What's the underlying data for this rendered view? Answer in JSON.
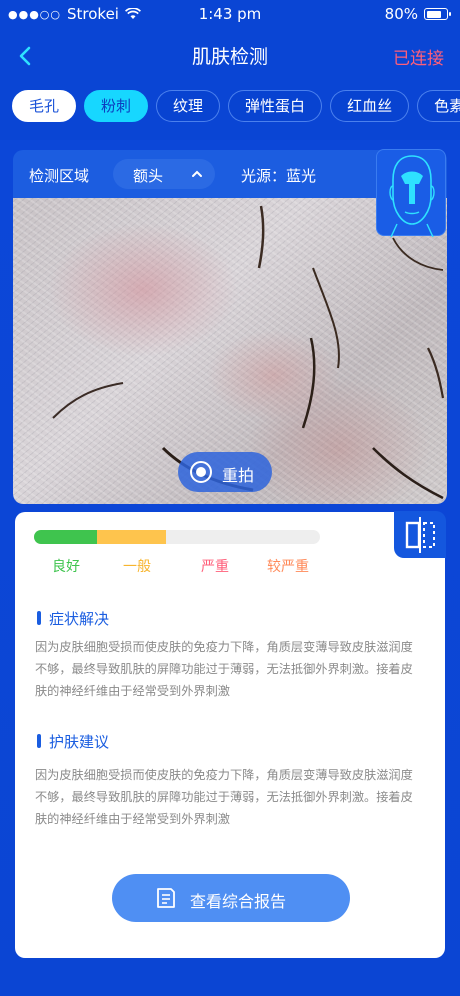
{
  "status_bar": {
    "carrier": "Strokei",
    "time": "1:43 pm",
    "battery_percent_text": "80%",
    "battery_level": 0.8
  },
  "nav": {
    "title": "肌肤检测",
    "connection_status": "已连接",
    "connection_color": "#ff5f7a"
  },
  "tabs": [
    {
      "label": "毛孔",
      "state": "white"
    },
    {
      "label": "粉刺",
      "state": "cyan"
    },
    {
      "label": "纹理",
      "state": "normal"
    },
    {
      "label": "弹性蛋白",
      "state": "normal"
    },
    {
      "label": "红血丝",
      "state": "normal"
    },
    {
      "label": "色素",
      "state": "normal"
    }
  ],
  "detection": {
    "region_label": "检测区域",
    "region_value": "额头",
    "light_source": "光源：蓝光",
    "retake_label": "重拍"
  },
  "severity": {
    "green_fraction": 0.22,
    "yellow_fraction": 0.24,
    "levels": [
      {
        "label": "良好",
        "color": "#3fc44e"
      },
      {
        "label": "一般",
        "color": "#f7b52e"
      },
      {
        "label": "严重",
        "color": "#ff5f7a"
      },
      {
        "label": "较严重",
        "color": "#ff8a5a"
      }
    ]
  },
  "symptom": {
    "title": "症状解决",
    "lines": [
      "因为皮肤细胞受损而使皮肤的免疫力下降，角质层变薄导致皮肤滋润度",
      "不够，最终导致肌肤的屏障功能过于薄弱，无法抵御外界刺激。接着皮",
      "肤的神经纤维由于经常受到外界刺激"
    ]
  },
  "advice": {
    "title": "护肤建议",
    "lines": [
      "因为皮肤细胞受损而使皮肤的免疫力下降，角质层变薄导致皮肤滋润度",
      "不够，最终导致肌肤的屏障功能过于薄弱，无法抵御外界刺激。接着皮",
      "肤的神经纤维由于经常受到外界刺激"
    ]
  },
  "report_button": "查看综合报告",
  "colors": {
    "background": "#0b47d6",
    "accent": "#1a5de0",
    "tab_active_cyan": "#17d7ff",
    "report_button": "#4f8ff3"
  }
}
